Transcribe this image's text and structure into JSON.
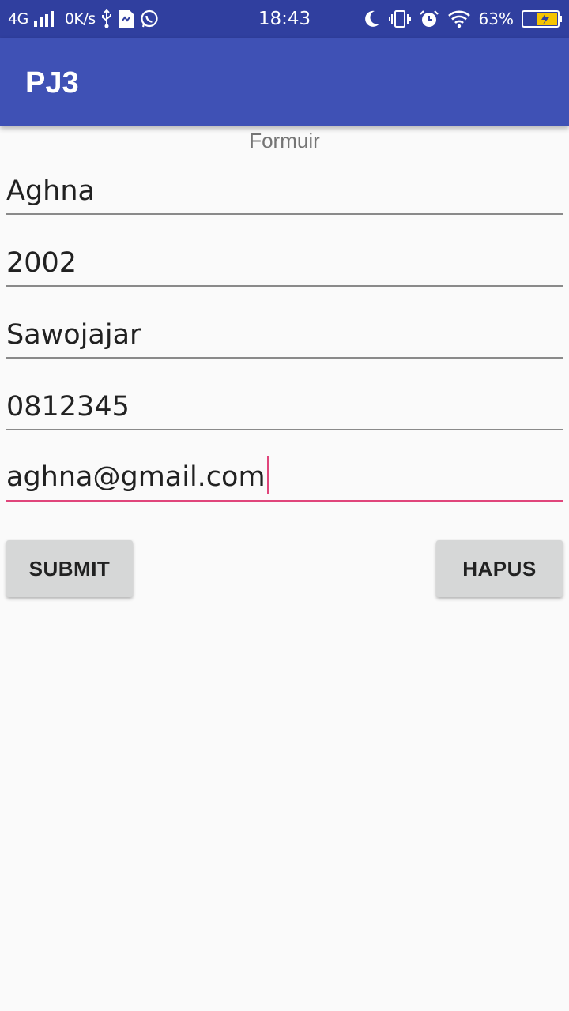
{
  "status_bar": {
    "network": "4G",
    "speed": "0K/s",
    "time": "18:43",
    "battery_percent": "63%",
    "battery_level": 0.63,
    "icons": [
      "signal-icon",
      "usb-icon",
      "sim-icon",
      "whatsapp-icon",
      "moon-icon",
      "vibrate-icon",
      "alarm-icon",
      "wifi-icon",
      "battery-icon"
    ]
  },
  "app_bar": {
    "title": "PJ3"
  },
  "form": {
    "heading": "Formuir",
    "fields": [
      {
        "value": "Aghna"
      },
      {
        "value": "2002"
      },
      {
        "value": "Sawojajar"
      },
      {
        "value": "0812345"
      },
      {
        "value": "aghna@gmail.com",
        "focused": true
      }
    ]
  },
  "buttons": {
    "submit": "SUBMIT",
    "clear": "HAPUS"
  },
  "colors": {
    "status_bar": "#303f9f",
    "app_bar": "#3f51b5",
    "accent": "#e0457b",
    "background": "#fafafa",
    "button": "#d6d7d7"
  }
}
